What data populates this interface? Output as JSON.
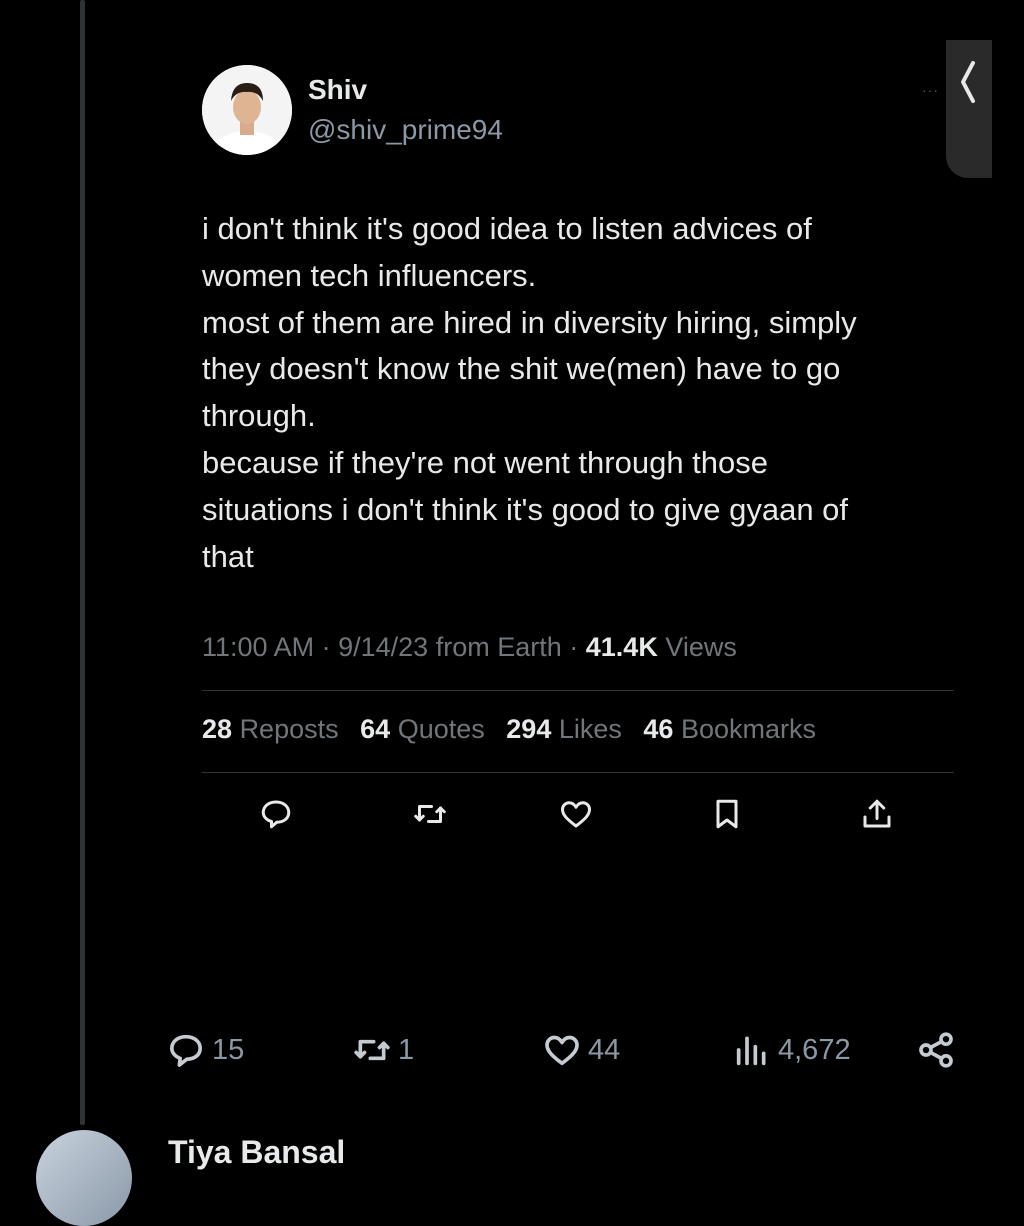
{
  "author": {
    "name": "Shiv",
    "handle": "@shiv_prime94"
  },
  "tweet": {
    "text": "i don't think it's good idea to listen advices of\nwomen tech influencers.\nmost of them are hired in diversity hiring, simply\nthey doesn't know the shit we(men) have to go\nthrough.\nbecause if they're not went through those\nsituations i don't think it's good to give gyaan of\nthat"
  },
  "meta": {
    "time": "11:00 AM",
    "date": "9/14/23",
    "source": "from Earth",
    "views_count": "41.4K",
    "views_label": "Views"
  },
  "stats": {
    "reposts_count": "28",
    "reposts_label": "Reposts",
    "quotes_count": "64",
    "quotes_label": "Quotes",
    "likes_count": "294",
    "likes_label": "Likes",
    "bookmarks_count": "46",
    "bookmarks_label": "Bookmarks"
  },
  "actions": [
    "reply-icon",
    "repost-icon",
    "like-icon",
    "bookmark-icon",
    "share-icon"
  ],
  "bottom_bar": {
    "replies": "15",
    "reposts": "1",
    "likes": "44",
    "views": "4,672"
  },
  "next_reply": {
    "name": "Tiya Bansal"
  },
  "side_tab": {
    "dots": "···"
  },
  "colors": {
    "background": "#000000",
    "text": "#e7e9ea",
    "muted": "#71767b",
    "divider": "#2f3336"
  }
}
